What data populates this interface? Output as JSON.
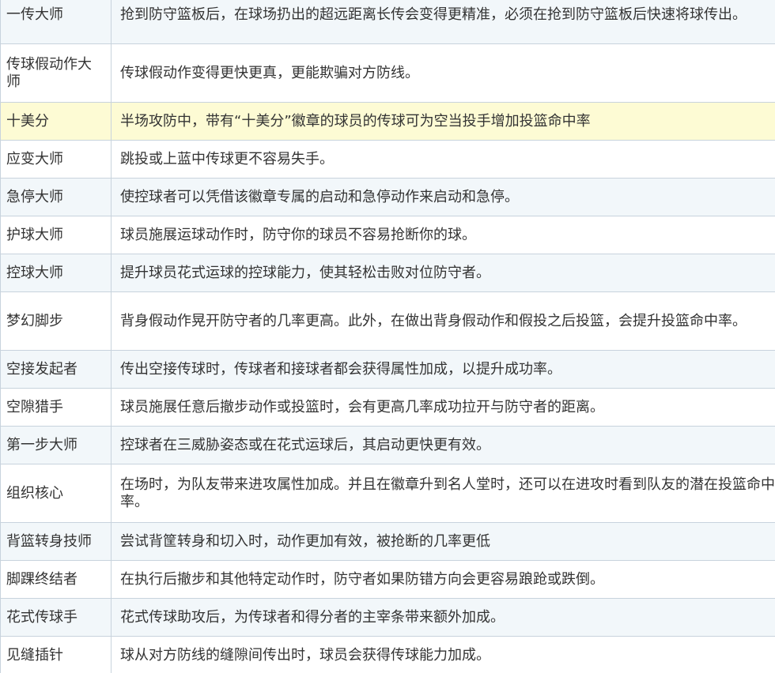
{
  "badges": {
    "rows": [
      {
        "name": "一传大师",
        "desc": "抢到防守篮板后，在球场扔出的超远距离长传会变得更精准，必须在抢到防守篮板后快速将球传出。"
      },
      {
        "name": "传球假动作大师",
        "desc": "传球假动作变得更快更真，更能欺骗对方防线。"
      },
      {
        "name": "十美分",
        "desc": "半场攻防中，带有“十美分”徽章的球员的传球可为空当投手增加投篮命中率"
      },
      {
        "name": "应变大师",
        "desc": "跳投或上蓝中传球更不容易失手。"
      },
      {
        "name": "急停大师",
        "desc": "使控球者可以凭借该徽章专属的启动和急停动作来启动和急停。"
      },
      {
        "name": "护球大师",
        "desc": "球员施展运球动作时，防守你的球员不容易抢断你的球。"
      },
      {
        "name": "控球大师",
        "desc": "提升球员花式运球的控球能力，使其轻松击败对位防守者。"
      },
      {
        "name": "梦幻脚步",
        "desc": "背身假动作晃开防守者的几率更高。此外，在做出背身假动作和假投之后投篮，会提升投篮命中率。"
      },
      {
        "name": "空接发起者",
        "desc": "传出空接传球时，传球者和接球者都会获得属性加成，以提升成功率。"
      },
      {
        "name": "空隙猎手",
        "desc": "球员施展任意后撤步动作或投篮时，会有更高几率成功拉开与防守者的距离。"
      },
      {
        "name": "第一步大师",
        "desc": "控球者在三威胁姿态或在花式运球后，其启动更快更有效。"
      },
      {
        "name": "组织核心",
        "desc": "在场时，为队友带来进攻属性加成。并且在徽章升到名人堂时，还可以在进攻时看到队友的潜在投篮命中率。"
      },
      {
        "name": "背篮转身技师",
        "desc": "尝试背筐转身和切入时，动作更加有效，被抢断的几率更低"
      },
      {
        "name": "脚踝终结者",
        "desc": "在执行后撤步和其他特定动作时，防守者如果防错方向会更容易踉跄或跌倒。"
      },
      {
        "name": "花式传球手",
        "desc": "花式传球助攻后，为传球者和得分者的主宰条带来额外加成。"
      },
      {
        "name": "见缝插针",
        "desc": "球从对方防线的缝隙间传出时，球员会获得传球能力加成。"
      }
    ]
  },
  "colors": {
    "border": "#c8d3dd",
    "row_alt": "#f2f7fa",
    "row_highlight": "#fdfbd4",
    "text": "#333333"
  }
}
